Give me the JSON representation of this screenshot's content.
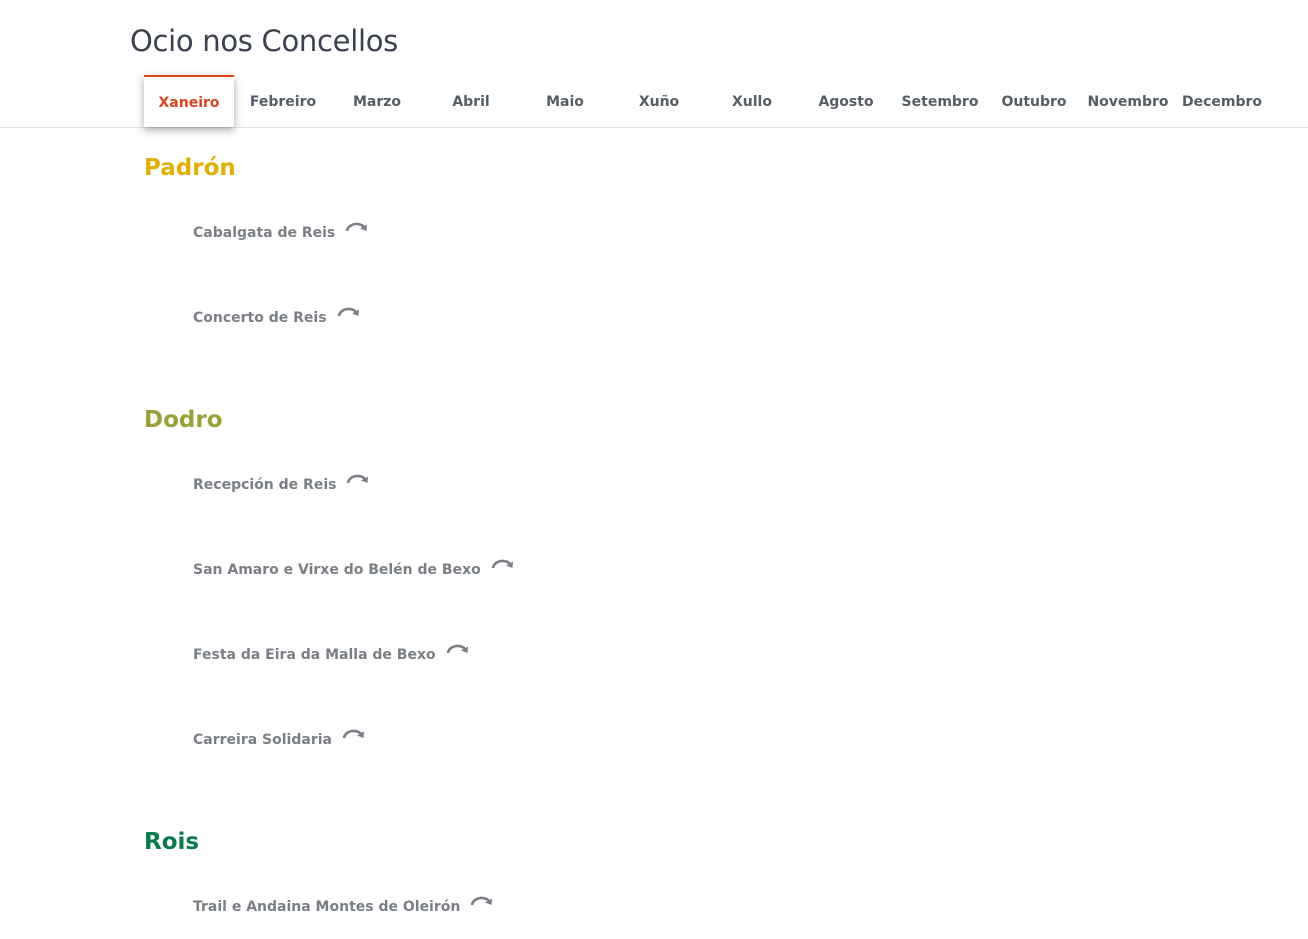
{
  "page_title": "Ocio nos Concellos",
  "months": [
    "Xaneiro",
    "Febreiro",
    "Marzo",
    "Abril",
    "Maio",
    "Xuño",
    "Xullo",
    "Agosto",
    "Setembro",
    "Outubro",
    "Novembro",
    "Decembro"
  ],
  "active_month": "Xaneiro",
  "colors": {
    "active_tab": "#d9441a",
    "padron": "#e0b000",
    "dodro": "#9aa138",
    "rois": "#087a4e"
  },
  "sections": [
    {
      "name": "Padrón",
      "events": [
        "Cabalgata de Reis",
        "Concerto de Reis"
      ]
    },
    {
      "name": "Dodro",
      "events": [
        "Recepción de Reis",
        "San Amaro e Virxe do Belén de Bexo",
        "Festa da Eira da Malla de Bexo",
        "Carreira Solidaria"
      ]
    },
    {
      "name": "Rois",
      "events": [
        "Trail e Andaina Montes de Oleirón"
      ]
    }
  ],
  "icon_name": "recurring-arrow-icon"
}
